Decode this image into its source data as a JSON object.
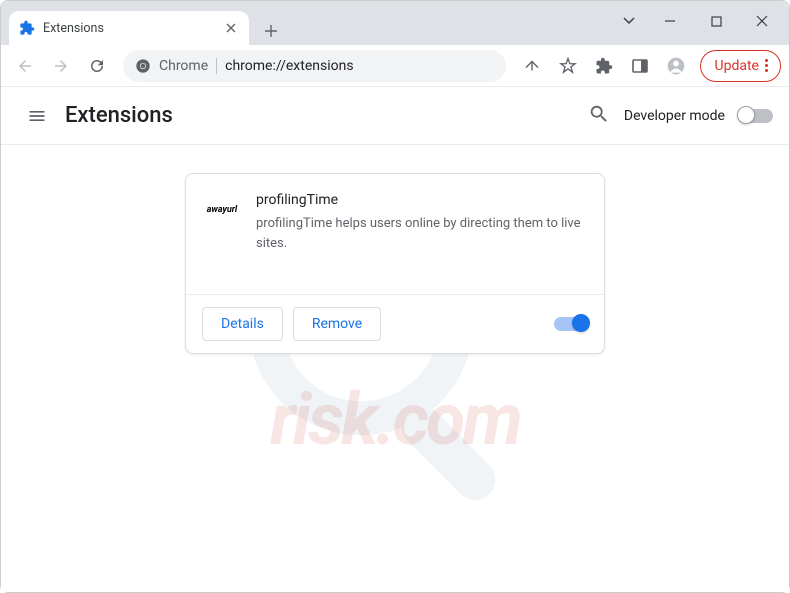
{
  "tab": {
    "title": "Extensions"
  },
  "omnibox": {
    "prefix": "Chrome",
    "url": "chrome://extensions"
  },
  "toolbar": {
    "update_label": "Update"
  },
  "page": {
    "title": "Extensions",
    "dev_mode_label": "Developer mode"
  },
  "extension": {
    "icon_text": "awayurl",
    "name": "profilingTime",
    "description": "profilingTime helps users online by directing them to live sites.",
    "details_label": "Details",
    "remove_label": "Remove"
  },
  "watermark": {
    "text": "risk.com"
  }
}
